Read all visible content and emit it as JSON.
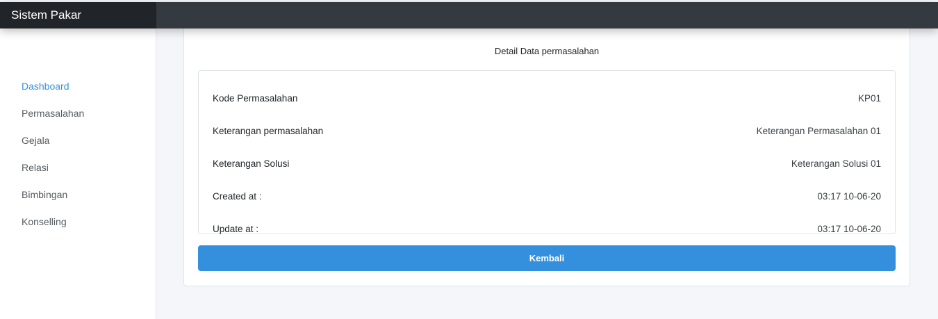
{
  "app": {
    "brand": "Sistem Pakar"
  },
  "sidebar": {
    "items": [
      {
        "label": "Dashboard",
        "active": true
      },
      {
        "label": "Permasalahan",
        "active": false
      },
      {
        "label": "Gejala",
        "active": false
      },
      {
        "label": "Relasi",
        "active": false
      },
      {
        "label": "Bimbingan",
        "active": false
      },
      {
        "label": "Konselling",
        "active": false
      }
    ]
  },
  "card": {
    "title": "Detail Data permasalahan",
    "rows": [
      {
        "label": "Kode Permasalahan",
        "value": "KP01"
      },
      {
        "label": "Keterangan permasalahan",
        "value": "Keterangan Permasalahan 01"
      },
      {
        "label": "Keterangan Solusi",
        "value": "Keterangan Solusi 01"
      },
      {
        "label": "Created at :",
        "value": "03:17 10-06-20"
      },
      {
        "label": "Update at :",
        "value": "03:17 10-06-20"
      }
    ],
    "back_label": "Kembali"
  },
  "colors": {
    "accent": "#3490dc",
    "topbar": "#343a40",
    "brand_bg": "#212529"
  }
}
